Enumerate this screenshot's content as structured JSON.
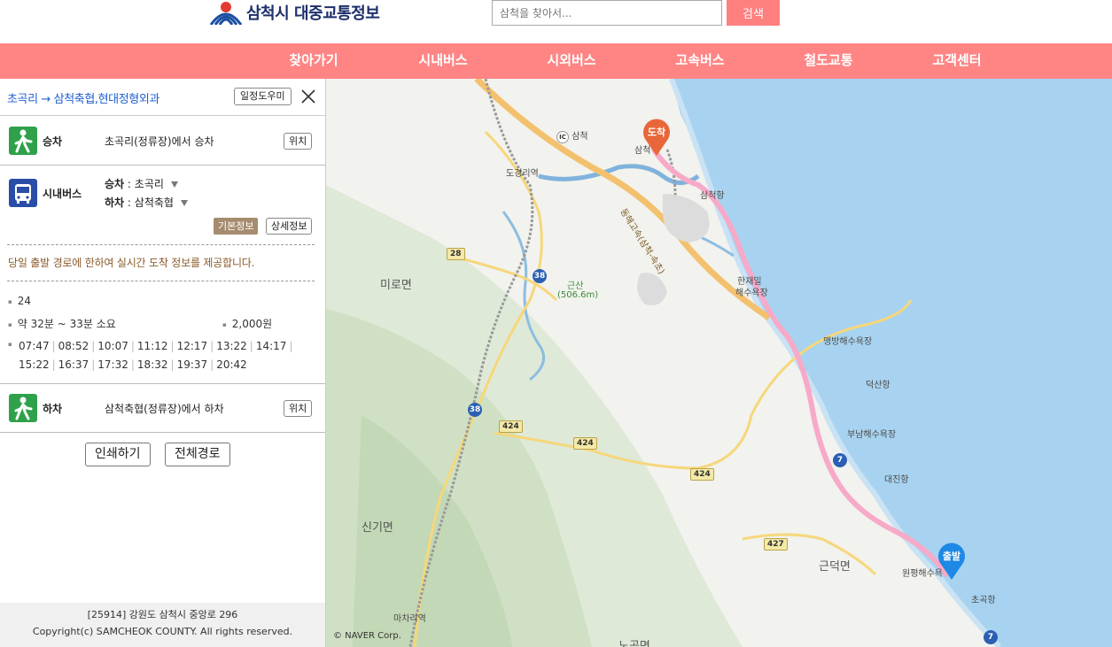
{
  "header": {
    "logo_text": "삼척시 대중교통정보",
    "search_placeholder": "삼척을 찾아서...",
    "search_button": "검색"
  },
  "nav": [
    "찾아가기",
    "시내버스",
    "시외버스",
    "고속버스",
    "철도교통",
    "고객센터"
  ],
  "route": {
    "title": "초곡리 → 삼척축협,현대정형외과",
    "help_button": "일정도우미"
  },
  "steps": {
    "board": {
      "label": "승차",
      "text": "초곡리(정류장)에서 승차",
      "button": "위치"
    },
    "bus": {
      "label": "시내버스",
      "board_key": "승차",
      "board_value": ": 초곡리",
      "alight_key": "하차",
      "alight_value": ": 삼척축협",
      "basic_info": "기본정보",
      "detail_info": "상세정보",
      "notice": "당일 출발 경로에 한하여 실시간 도착 정보를 제공합니다.",
      "route_no": "24",
      "duration": "약 32분 ~ 33분 소요",
      "fare": "2,000원",
      "times": [
        "07:47",
        "08:52",
        "10:07",
        "11:12",
        "12:17",
        "13:22",
        "14:17",
        "15:22",
        "16:37",
        "17:32",
        "18:32",
        "19:37",
        "20:42"
      ]
    },
    "alight": {
      "label": "하차",
      "text": "삼척축협(정류장)에서 하차",
      "button": "위치"
    }
  },
  "actions": {
    "print": "인쇄하기",
    "full_route": "전체경로"
  },
  "footer": {
    "address": "[25914] 강원도 삼척시 중앙로 296",
    "copyright": "Copyright(c) SAMCHEOK COUNTY. All rights reserved."
  },
  "map": {
    "labels": {
      "samcheok_ic": "삼척",
      "dogyeong_station": "도경리역",
      "samcheok_port": "삼척항",
      "hanjaemil_1": "한재밀",
      "hanjaemil_2": "해수욕장",
      "maengbang": "맹방해수욕장",
      "deoksan": "덕산항",
      "bunam": "부남해수욕장",
      "daejin": "대진항",
      "miro": "미로면",
      "geunsan": "근산",
      "geunsan_height": "(506.6m)",
      "singi": "신기면",
      "geundeok": "근덕면",
      "wonpyeong": "원평해수욕",
      "chogok_port": "초곡항",
      "machari": "마차리역",
      "nogok": "노곡면",
      "expressway": "동해고속(삼척-속초)",
      "samcheok_town": "삼척"
    },
    "shields": [
      "28",
      "38",
      "38",
      "424",
      "424",
      "424",
      "427"
    ],
    "route_badges": [
      "7",
      "7"
    ],
    "ic_badge": "IC",
    "markers": {
      "arrive": "도착",
      "depart": "출발"
    },
    "copyright": "© NAVER Corp."
  },
  "colors": {
    "nav_bg": "#ff8585",
    "search_btn": "#ff7f7f",
    "link_blue": "#1f5fd1",
    "walk_green": "#2fa14a",
    "bus_blue": "#2a4ea7",
    "sea": "#a8d3f0",
    "route_pink": "#f7a9c8",
    "arrive_marker": "#e8673a",
    "depart_marker": "#1e88e5"
  }
}
